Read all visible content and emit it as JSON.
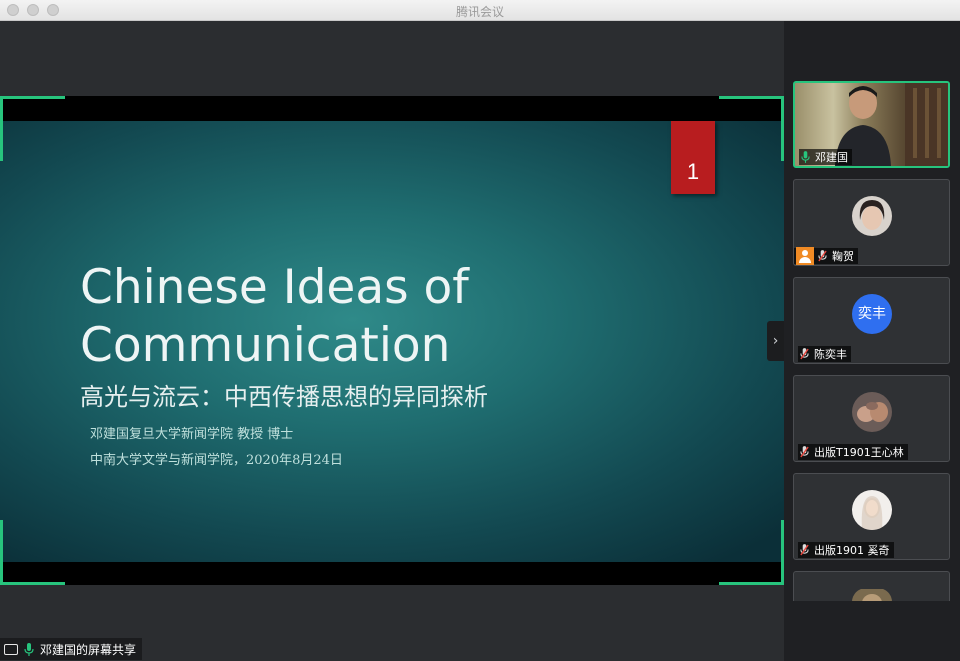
{
  "window": {
    "title": "腾讯会议"
  },
  "slide": {
    "number": "1",
    "title_line1": "Chinese Ideas of",
    "title_line2": "Communication",
    "subtitle": "高光与流云：中西传播思想的异同探析",
    "line1": "邓建国复旦大学新闻学院  教授  博士",
    "line2": "中南大学文学与新闻学院，2020年8月24日"
  },
  "share_bar": {
    "label": "邓建国的屏幕共享"
  },
  "participants": [
    {
      "name": "邓建国",
      "mic": "on",
      "video": true,
      "active": true
    },
    {
      "name": "鞠贺",
      "mic": "muted",
      "host": true,
      "avatar": "photo"
    },
    {
      "name": "陈奕丰",
      "mic": "muted",
      "avatar_text": "奕丰"
    },
    {
      "name": "出版T1901王心林",
      "mic": "muted",
      "avatar": "photo"
    },
    {
      "name": "出版1901 奚奇",
      "mic": "muted",
      "avatar": "photo"
    }
  ],
  "colors": {
    "accent_green": "#27c47d",
    "slide_number_bg": "#b81d1f",
    "avatar_blue": "#2f6ff0",
    "host_orange": "#f08a24"
  }
}
